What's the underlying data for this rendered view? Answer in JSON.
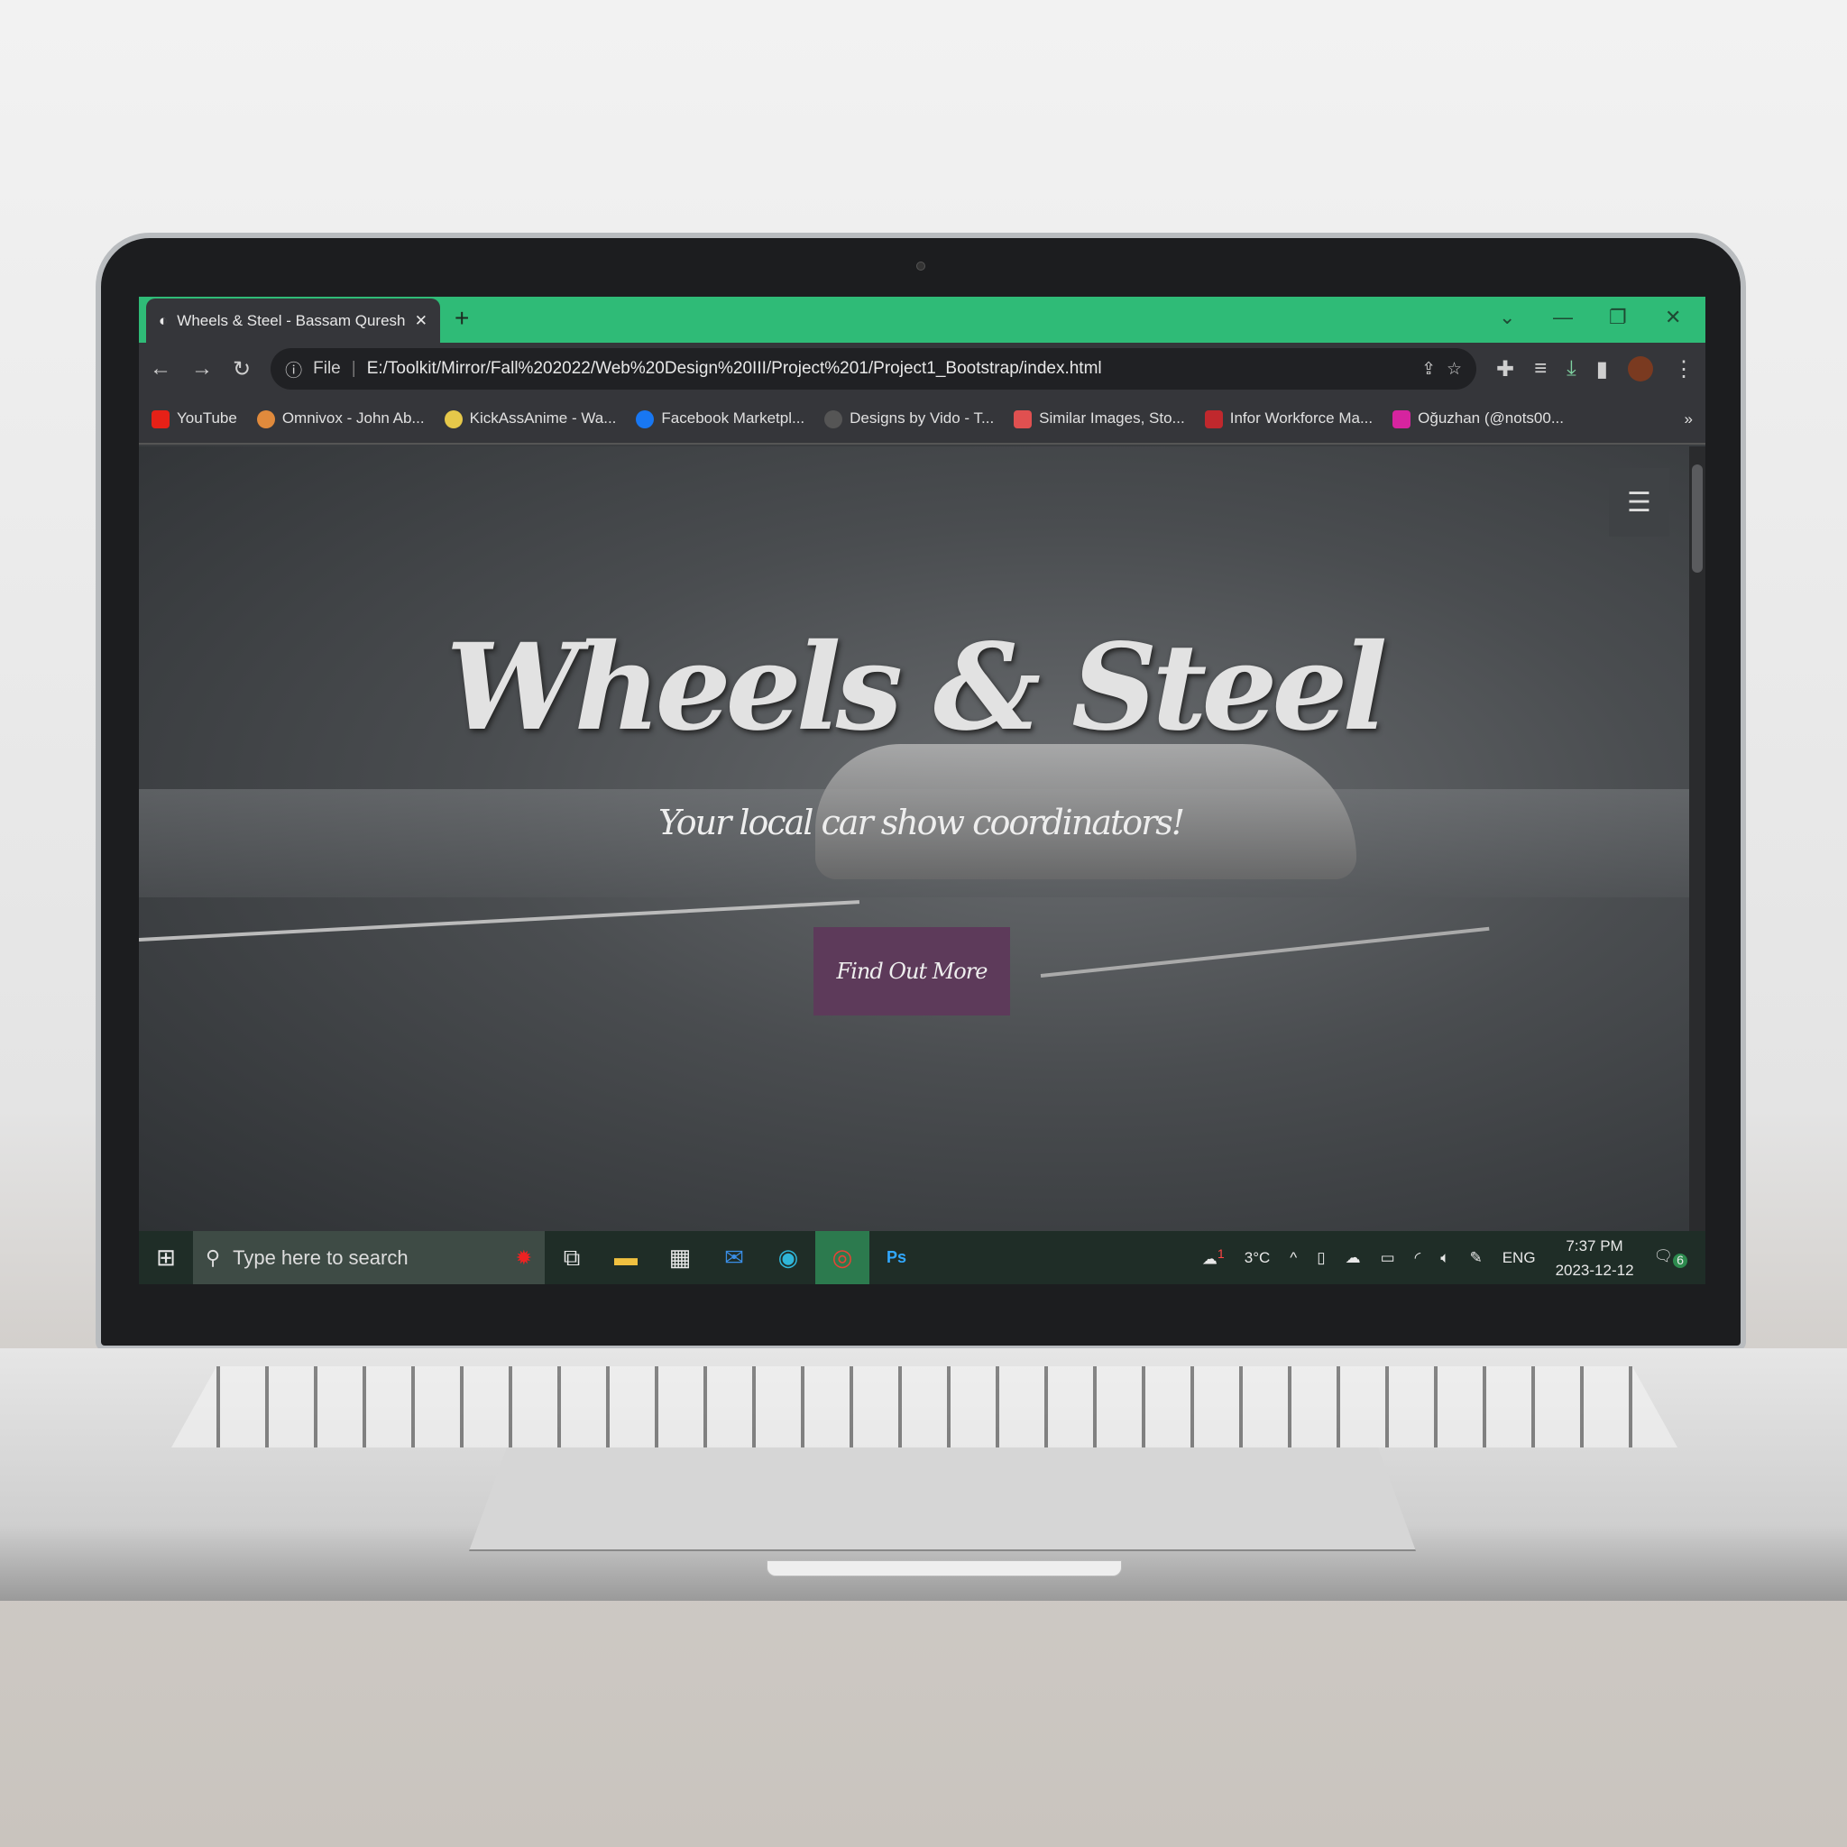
{
  "browser": {
    "tab_title": "Wheels & Steel - Bassam Qureshi",
    "new_tab": "+",
    "address_scheme": "File",
    "url": "E:/Toolkit/Mirror/Fall%202022/Web%20Design%20III/Project%201/Project1_Bootstrap/index.html",
    "accent": "#2fbb77",
    "bookmarks": [
      {
        "label": "YouTube",
        "color": "#e62117"
      },
      {
        "label": "Omnivox - John Ab...",
        "color": "#e08a3c"
      },
      {
        "label": "KickAssAnime - Wa...",
        "color": "#e6c84a"
      },
      {
        "label": "Facebook Marketpl...",
        "color": "#1877f2"
      },
      {
        "label": "Designs by Vido - T...",
        "color": "#555555"
      },
      {
        "label": "Similar Images, Sto...",
        "color": "#e05050"
      },
      {
        "label": "Infor Workforce Ma...",
        "color": "#c0282d"
      },
      {
        "label": "Oğuzhan (@nots00...",
        "color": "#d6249f"
      }
    ],
    "more": "»"
  },
  "page": {
    "title": "Wheels & Steel",
    "subtitle": "Your local car show coordinators!",
    "cta": "Find Out More",
    "menu_icon": "☰",
    "cta_color": "#5d3a5a"
  },
  "taskbar": {
    "search_placeholder": "Type here to search",
    "weather": "3°C",
    "weather_badge": "1",
    "language": "ENG",
    "time": "7:37 PM",
    "date": "2023-12-12",
    "notifications": "6"
  }
}
